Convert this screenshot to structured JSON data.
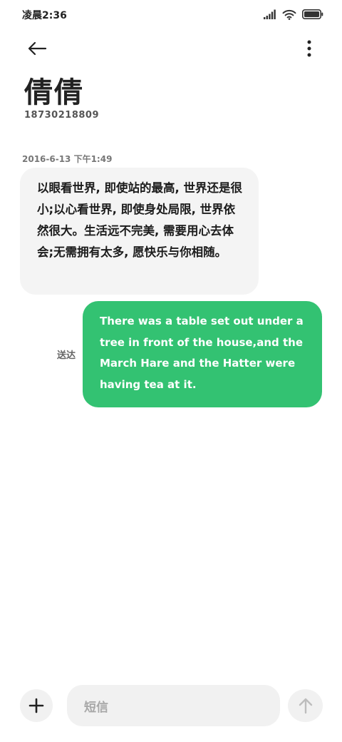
{
  "status_bar": {
    "time": "凌晨2:36",
    "icons": [
      "signal-icon",
      "wifi-icon",
      "battery-icon"
    ]
  },
  "nav": {
    "back_icon": "back-arrow-icon",
    "more_icon": "more-vertical-icon"
  },
  "contact": {
    "name": "倩倩",
    "number": "18730218809"
  },
  "conversation": {
    "timestamp": "2016-6-13 下午1:49",
    "incoming_message": "以眼看世界, 即使站的最高, 世界还是很小;以心看世界, 即使身处局限, 世界依然很大。生活远不完美, 需要用心去体会;无需拥有太多, 愿快乐与你相随。",
    "outgoing_message": "There was a table set out under a tree in front of the house,and the March Hare and the Hatter were having tea at it.",
    "delivery_status": "送达"
  },
  "input_bar": {
    "add_icon": "plus-icon",
    "placeholder": "短信",
    "send_icon": "arrow-up-icon"
  },
  "colors": {
    "outgoing_bubble": "#33c272",
    "incoming_bubble": "#f4f4f4",
    "input_background": "#f1f1f1"
  }
}
